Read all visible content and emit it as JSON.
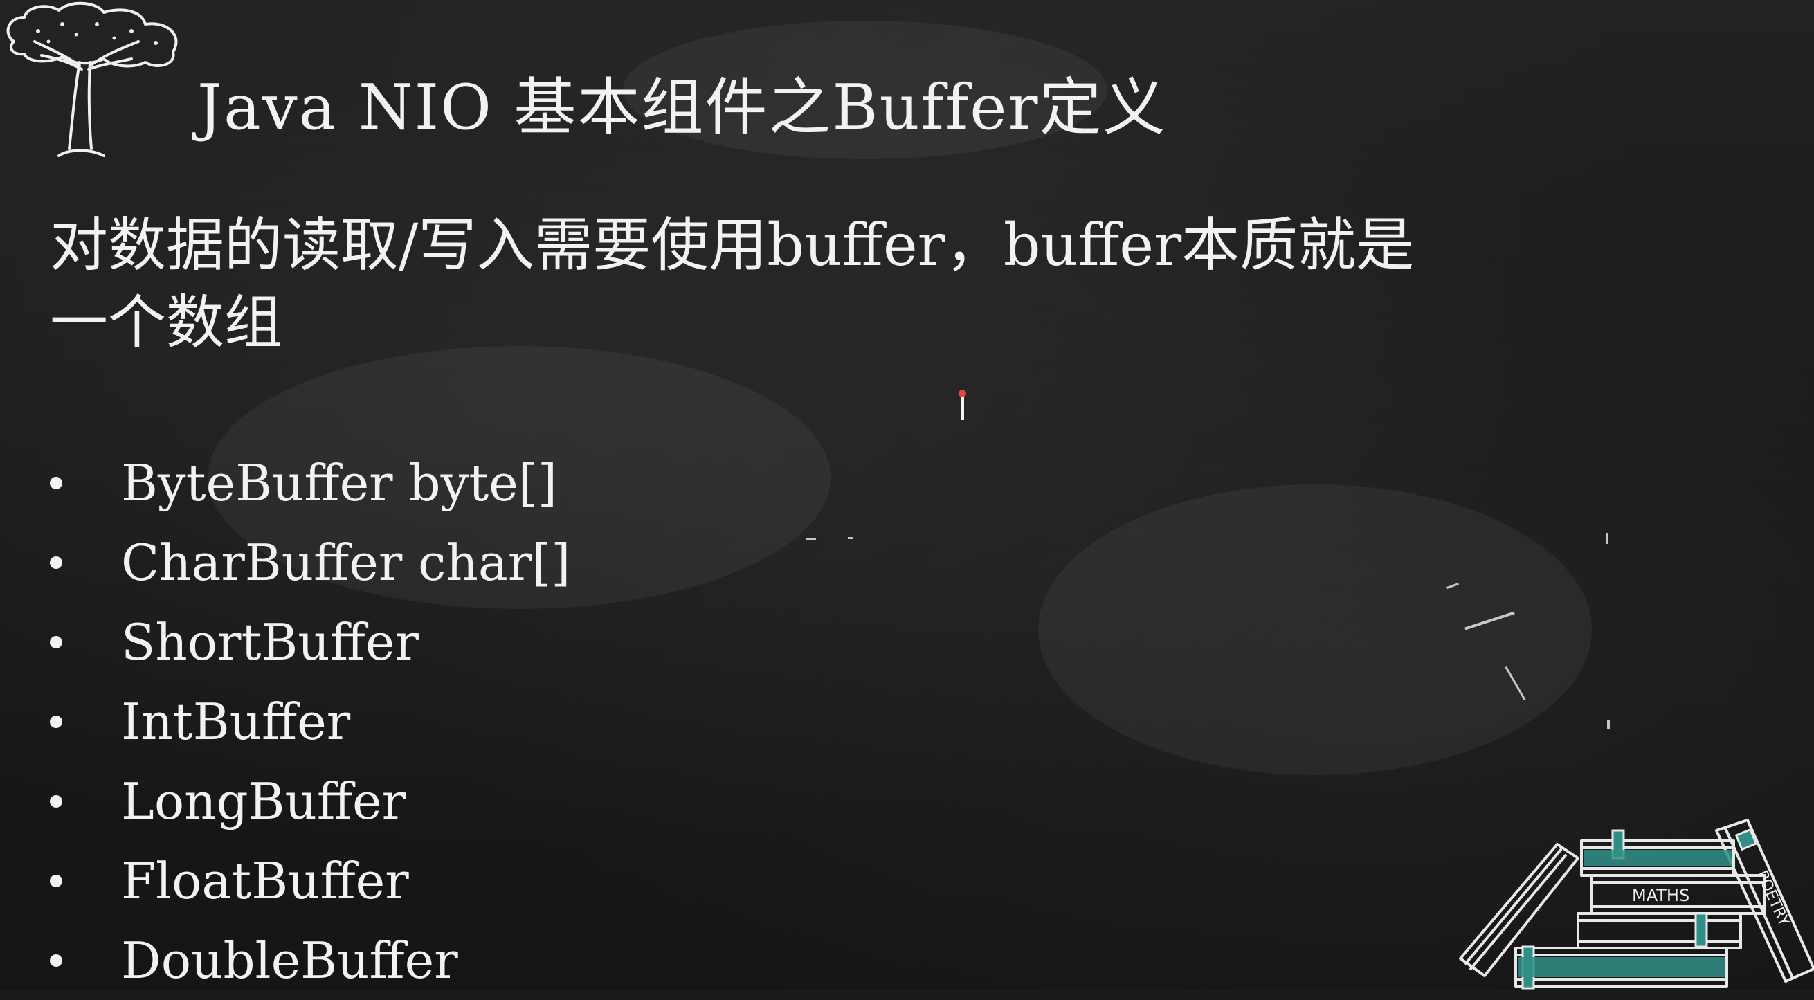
{
  "slide": {
    "title": "Java NIO 基本组件之Buffer定义",
    "subtitle_line1": "对数据的读取/写入需要使用buffer，buffer本质就是",
    "subtitle_line2": "一个数组",
    "bullets": [
      "ByteBuffer byte[]",
      "CharBuffer char[]",
      "ShortBuffer",
      "IntBuffer",
      "LongBuffer",
      "FloatBuffer",
      "DoubleBuffer"
    ]
  },
  "decorations": {
    "tree_icon": "tree-icon",
    "books_icon": "books-icon",
    "book_labels": {
      "maths": "MATHS",
      "poetry": "POETRY"
    }
  },
  "colors": {
    "background": "#1b1b1b",
    "text": "#f2f2f2",
    "cursor_tip": "#e04a3a",
    "book_teal": "#2f8f86"
  }
}
